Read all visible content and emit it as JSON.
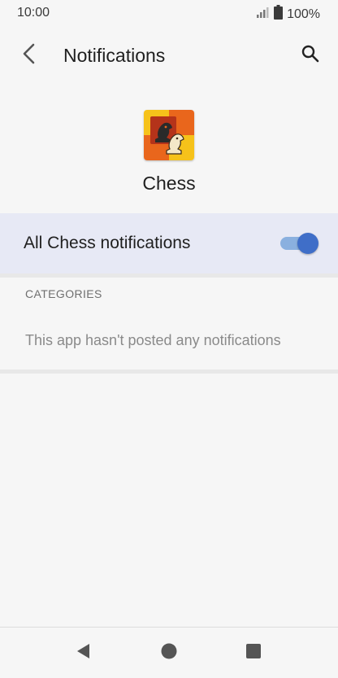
{
  "status_bar": {
    "time": "10:00",
    "battery_percent": "100%",
    "icons": [
      "signal-icon",
      "battery-icon"
    ]
  },
  "app_bar": {
    "title": "Notifications",
    "icons": [
      "back-arrow-icon",
      "search-icon"
    ]
  },
  "app": {
    "name": "Chess",
    "icon": "chess-app-icon"
  },
  "master_toggle": {
    "label": "All Chess notifications",
    "enabled": true
  },
  "categories": {
    "header": "CATEGORIES",
    "empty_message": "This app hasn't posted any notifications"
  },
  "nav_bar": {
    "icons": [
      "nav-back-icon",
      "nav-home-icon",
      "nav-recents-icon"
    ]
  },
  "colors": {
    "background": "#f6f6f6",
    "highlight_row": "#e7e9f5",
    "toggle_thumb": "#3f6ec8",
    "toggle_track": "#8ab0df"
  }
}
